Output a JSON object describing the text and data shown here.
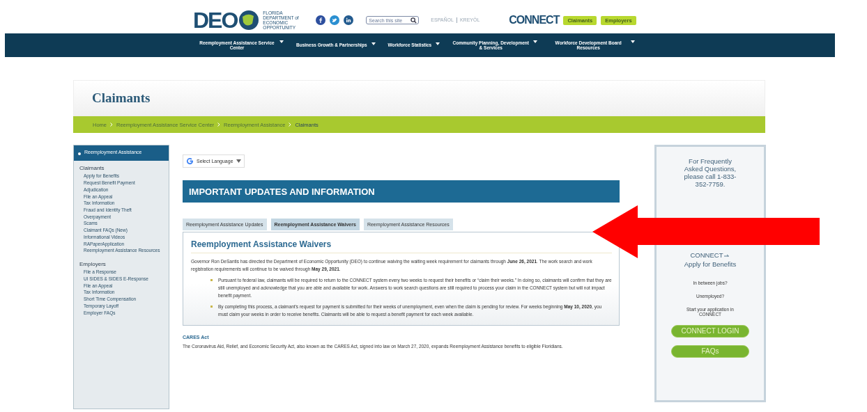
{
  "header": {
    "logo": "DEO",
    "logo_tagline": "FLORIDA DEPARTMENT of ECONOMIC OPPORTUNITY",
    "search": {
      "placeholder": "Search this site"
    },
    "languages": [
      "ESPAÑOL",
      "KREYÒL"
    ],
    "connect_logo": "CONNECT",
    "audience_buttons": [
      "Claimants",
      "Employers"
    ]
  },
  "nav": [
    {
      "label": "Reemployment Assistance Service Center"
    },
    {
      "label": "Business Growth & Partnerships"
    },
    {
      "label": "Workforce Statistics"
    },
    {
      "label": "Community Planning, Development & Services"
    },
    {
      "label": "Workforce Development Board Resources"
    }
  ],
  "page_title": "Claimants",
  "breadcrumb": [
    "Home",
    "Reemployment Assistance Service Center",
    "Reemployment Assistance",
    "Claimants"
  ],
  "sidebar": {
    "heading": "Reemployment Assistance",
    "sections": [
      {
        "title": "Claimants",
        "items": [
          "Apply for Benefits",
          "Request Benefit Payment",
          "Adjudication",
          "File an Appeal",
          "Tax Information",
          "Fraud and Identity Theft",
          "Overpayment",
          "Scams",
          "Claimant FAQs (New)",
          "Informational Videos",
          "RAPaperApplication",
          "Reemployment Assistance Resources"
        ]
      },
      {
        "title": "Employers",
        "items": [
          "File a Response",
          "UI SIDES & SIDES E-Response",
          "File an Appeal",
          "Tax Information",
          "Short Time Compensation",
          "Temporary Layoff",
          "Employer FAQs"
        ]
      }
    ]
  },
  "translate": {
    "label": "Select Language"
  },
  "banner": "IMPORTANT UPDATES AND INFORMATION",
  "tabs": [
    {
      "label": "Reemployment Assistance Updates",
      "selected": false
    },
    {
      "label": "Reemployment Assistance Waivers",
      "selected": true
    },
    {
      "label": "Reemployment Assistance Resources",
      "selected": false
    }
  ],
  "panel": {
    "heading": "Reemployment Assistance Waivers",
    "intro": "Governor Ron DeSantis has directed the Department of Economic Opportunity (DEO) to continue waiving the waiting week requirement for claimants through **June 26, 2021**. The work search and work registration requirements will continue to be waived through **May 29, 2021**.",
    "bullets": [
      "Pursuant to federal law, claimants will be required to return to the CONNECT system every two weeks to request their benefits or “claim their weeks.” In doing so, claimants will confirm that they are still unemployed and acknowledge that you are able and available for work. Answers to work search questions are still required to process your claim in the CONNECT system but will not impact benefit payment.",
      "By completing this process, a claimant’s request for payment is submitted for their weeks of unemployment, even when the claim is pending for review. For weeks beginning **May 10, 2020**, you must claim your weeks in order to receive benefits. Claimants will be able to request a benefit payment for each week available."
    ]
  },
  "cares": {
    "heading": "CARES Act",
    "text": "The Coronavirus Aid, Relief, and Economic Security Act, also known as the CARES Act, signed into law on March 27, 2020, expands Reemployment Assistance benefits to eligible Floridians."
  },
  "right_panel": {
    "faq_note": "For Frequently Asked Questions, please call 1-833-352-7759.",
    "apply_heading_1": "CONNECT",
    "apply_heading_2": "Apply for Benefits",
    "lines": [
      "In between jobs?",
      "Unemployed?",
      "Start your application in CONNECT"
    ],
    "buttons": [
      "CONNECT LOGIN",
      "FAQs"
    ]
  }
}
